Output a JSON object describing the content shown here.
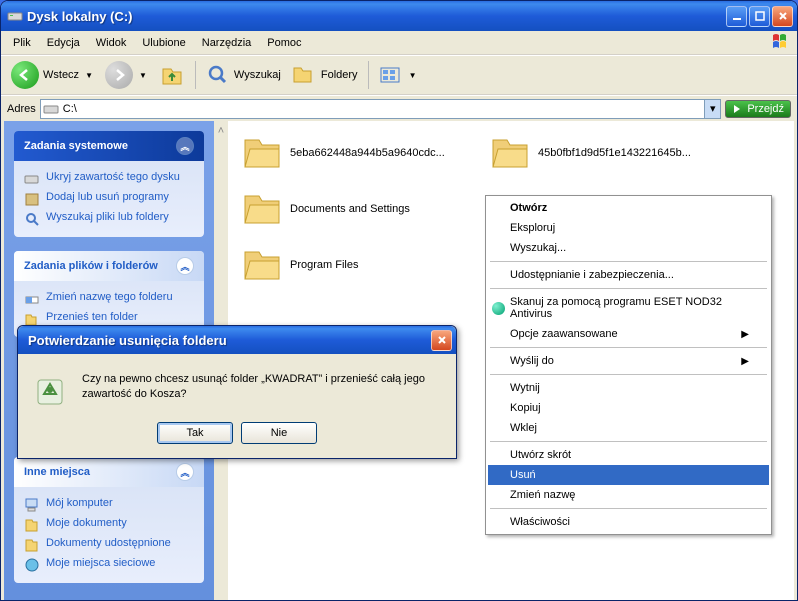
{
  "window": {
    "title": "Dysk lokalny (C:)",
    "menus": [
      "Plik",
      "Edycja",
      "Widok",
      "Ulubione",
      "Narzędzia",
      "Pomoc"
    ],
    "toolbar": {
      "back": "Wstecz",
      "search": "Wyszukaj",
      "folders": "Foldery"
    },
    "address": {
      "label": "Adres",
      "value": "C:\\",
      "go": "Przejdź"
    }
  },
  "sidebar": {
    "g1": {
      "title": "Zadania systemowe",
      "items": [
        "Ukryj zawartość tego dysku",
        "Dodaj lub usuń programy",
        "Wyszukaj pliki lub foldery"
      ]
    },
    "g2": {
      "title": "Zadania plików i folderów",
      "items": [
        "Zmień nazwę tego folderu",
        "Przenieś ten folder"
      ]
    },
    "g3": {
      "title": "Inne miejsca",
      "items": [
        "Mój komputer",
        "Moje dokumenty",
        "Dokumenty udostępnione",
        "Moje miejsca sieciowe"
      ]
    }
  },
  "folders": [
    "5eba662448a944b5a9640cdc...",
    "45b0fbf1d9d5f1e143221645b...",
    "Documents and Settings",
    "",
    "Program Files",
    ""
  ],
  "context": {
    "open": "Otwórz",
    "explore": "Eksploruj",
    "search": "Wyszukaj...",
    "share": "Udostępnianie i zabezpieczenia...",
    "eset": "Skanuj za pomocą programu ESET NOD32 Antivirus",
    "adv": "Opcje zaawansowane",
    "sendto": "Wyślij do",
    "cut": "Wytnij",
    "copy": "Kopiuj",
    "paste": "Wklej",
    "shortcut": "Utwórz skrót",
    "delete": "Usuń",
    "rename": "Zmień nazwę",
    "props": "Właściwości"
  },
  "dialog": {
    "title": "Potwierdzanie usunięcia folderu",
    "text": "Czy na pewno chcesz usunąć folder „KWADRAT” i przenieść całą jego zawartość do Kosza?",
    "yes": "Tak",
    "no": "Nie"
  }
}
